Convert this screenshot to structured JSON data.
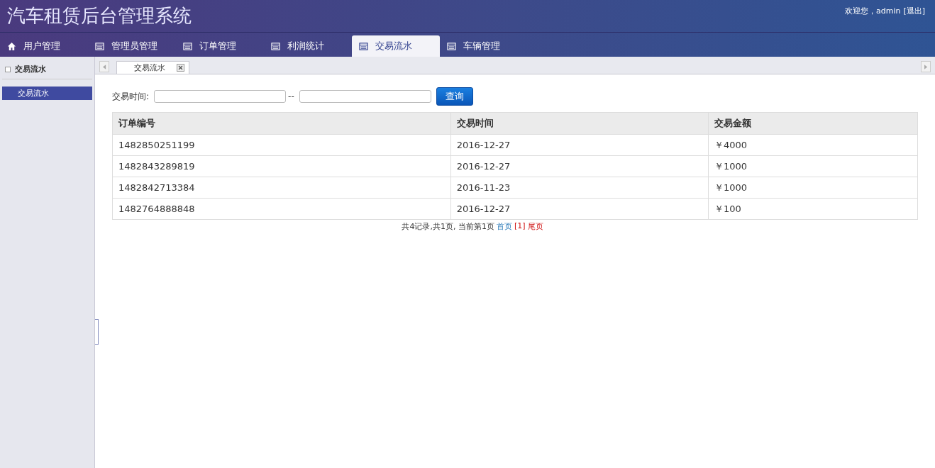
{
  "header": {
    "title": "汽车租赁后台管理系统",
    "welcome": "欢迎您，admin",
    "logout": "[退出]"
  },
  "nav": [
    {
      "label": "用户管理",
      "kind": "home",
      "selected": false
    },
    {
      "label": "管理员管理",
      "kind": "table",
      "selected": false
    },
    {
      "label": "订单管理",
      "kind": "table",
      "selected": false
    },
    {
      "label": "利润统计",
      "kind": "table",
      "selected": false
    },
    {
      "label": "交易流水",
      "kind": "table",
      "selected": true
    },
    {
      "label": "车辆管理",
      "kind": "table",
      "selected": false
    }
  ],
  "sidebar": {
    "heading": "交易流水",
    "items": [
      {
        "label": "交易流水",
        "selected": true
      }
    ]
  },
  "tabs": [
    {
      "label": "交易流水"
    }
  ],
  "filter": {
    "label": "交易时间:",
    "separator": "--",
    "button": "查询"
  },
  "table": {
    "columns": [
      "订单编号",
      "交易时间",
      "交易金额"
    ],
    "rows": [
      [
        "1482850251199",
        "2016-12-27",
        "￥4000"
      ],
      [
        "1482843289819",
        "2016-12-27",
        "￥1000"
      ],
      [
        "1482842713384",
        "2016-11-23",
        "￥1000"
      ],
      [
        "1482764888848",
        "2016-12-27",
        "￥100"
      ]
    ]
  },
  "pagination": {
    "summary": "共4记录,共1页, 当前第1页",
    "links": [
      {
        "label": "首页",
        "kind": "link"
      },
      {
        "label": "[1]",
        "kind": "current"
      },
      {
        "label": "尾页",
        "kind": "link-red"
      }
    ]
  }
}
